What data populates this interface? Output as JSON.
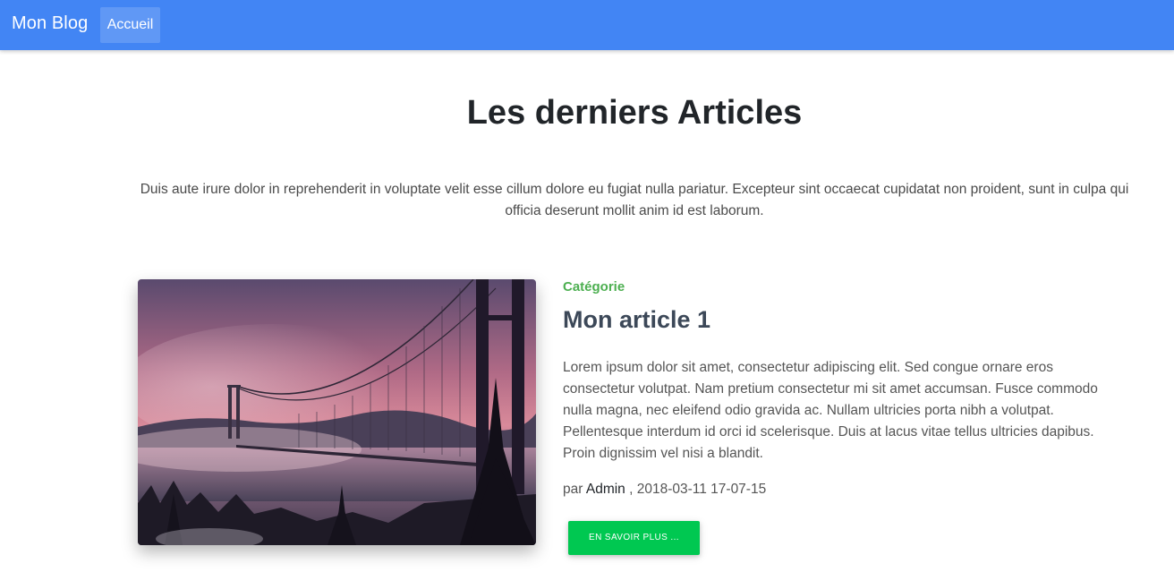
{
  "navbar": {
    "brand": "Mon Blog",
    "links": [
      {
        "label": "Accueil",
        "active": true
      }
    ],
    "color": "#4285f4"
  },
  "header": {
    "title": "Les derniers Articles",
    "intro": "Duis aute irure dolor in reprehenderit in voluptate velit esse cillum dolore eu fugiat nulla pariatur. Excepteur sint occaecat cupidatat non proident, sunt in culpa qui officia deserunt mollit anim id est laborum."
  },
  "articles": [
    {
      "category": "Catégorie",
      "title": "Mon article 1",
      "excerpt": "Lorem ipsum dolor sit amet, consectetur adipiscing elit. Sed congue ornare eros consectetur volutpat. Nam pretium consectetur mi sit amet accumsan. Fusce commodo nulla magna, nec eleifend odio gravida ac. Nullam ultricies porta nibh a volutpat. Pellentesque interdum id orci id scelerisque. Duis at lacus vitae tellus ultricies dapibus. Proin dignissim vel nisi a blandit.",
      "meta_prefix": "par",
      "author": "Admin",
      "date": ", 2018-03-11 17-07-15",
      "read_more": "EN SAVOIR PLUS ...",
      "image_icon": "bridge-photo",
      "category_color": "#4caf50",
      "button_color": "#00c851"
    }
  ]
}
